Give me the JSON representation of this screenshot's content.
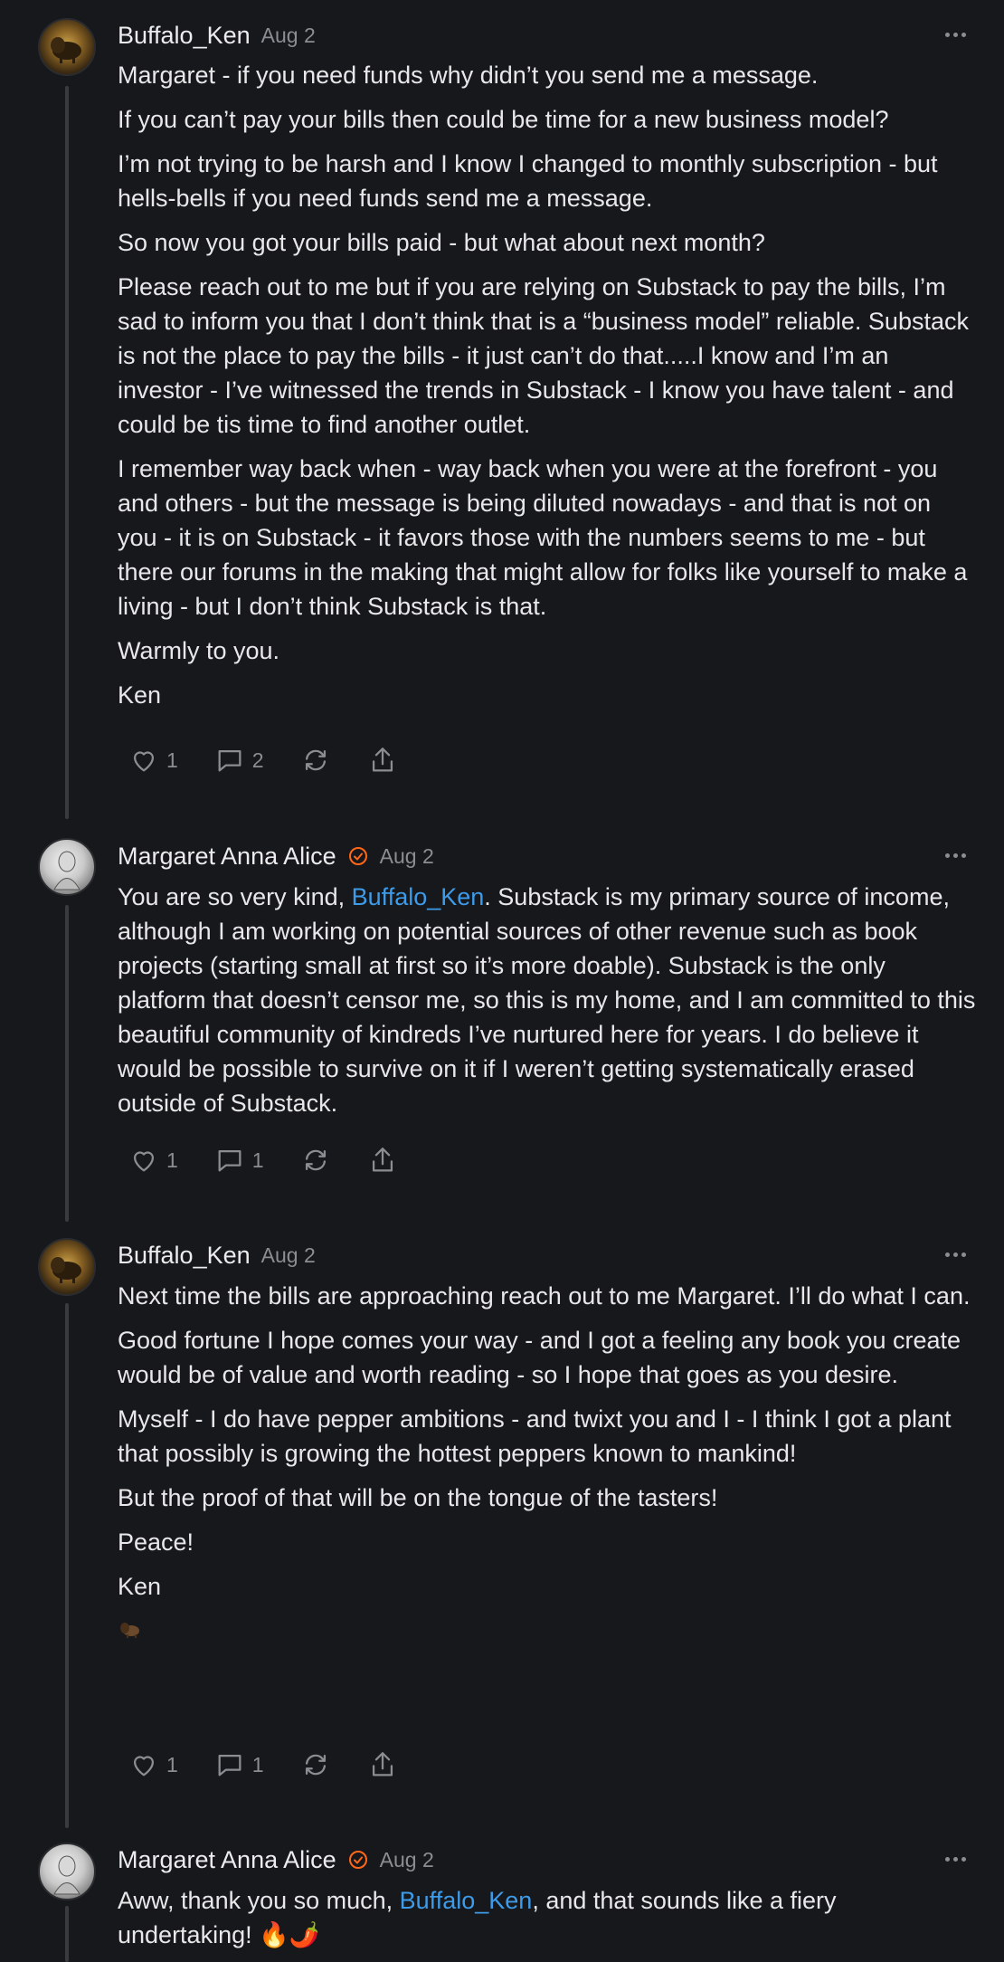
{
  "comments": [
    {
      "author": "Buffalo_Ken",
      "date": "Aug 2",
      "paragraphs": [
        "Margaret - if you need funds why didn’t you send me a message.",
        "If you can’t pay your bills then could be time for a new business model?",
        "I’m not trying to be harsh and I know I changed to monthly subscription - but hells-bells if you need funds send me a message.",
        "So now you got your bills paid - but what about next month?",
        "Please reach out to me but if you are relying on Substack to pay the bills, I’m sad to inform you that I don’t think that is a “business model” reliable. Substack is not the place to pay the bills - it just can’t do that.....I know and I’m an investor - I’ve witnessed the trends in Substack - I know you have talent - and could be tis time to find another outlet.",
        "I remember way back when - way back when you were at the forefront - you and others - but the message is being diluted nowadays - and that is not on you - it is on Substack - it favors those with the numbers seems to me - but there our forums in the making that might allow for folks like yourself to make a living - but I don’t think Substack is that.",
        "Warmly to you.",
        "Ken"
      ],
      "likes": "1",
      "replies": "2"
    },
    {
      "author": "Margaret Anna Alice",
      "date": "Aug 2",
      "text_before": "You are so very kind, ",
      "mention": "Buffalo_Ken",
      "text_after": ". Substack is my primary source of income, although I am working on potential sources of other revenue such as book projects (starting small at first so it’s more doable). Substack is the only platform that doesn’t censor me, so this is my home, and I am committed to this beautiful community of kindreds I’ve nurtured here for years. I do believe it would be possible to survive on it if I weren’t getting systematically erased outside of Substack.",
      "likes": "1",
      "replies": "1"
    },
    {
      "author": "Buffalo_Ken",
      "date": "Aug 2",
      "paragraphs": [
        "Next time the bills are approaching reach out to me Margaret. I’ll do what I can.",
        "Good fortune I hope comes your way - and I got a feeling any book you create would be of value and worth reading - so I hope that goes as you desire.",
        "Myself - I do have pepper ambitions - and twixt you and I - I think I got a plant that possibly is growing the hottest peppers known to mankind!",
        "But the proof of that will be on the tongue of the tasters!",
        "Peace!",
        "Ken"
      ],
      "likes": "1",
      "replies": "1"
    },
    {
      "author": "Margaret Anna Alice",
      "date": "Aug 2",
      "text_before": "Aww, thank you so much, ",
      "mention": "Buffalo_Ken",
      "text_after": ", and that sounds like a fiery undertaking! 🔥🌶️"
    }
  ],
  "icons": {
    "like": "heart-icon",
    "reply": "comment-bubble-icon",
    "restack": "restack-icon",
    "share": "share-icon",
    "more": "more-dots-icon",
    "verified": "verified-check-icon",
    "bison": "bison-emoji-icon"
  },
  "colors": {
    "background": "#17181b",
    "mention": "#3d9be9",
    "verified": "#ff6719",
    "muted": "#8c8d92"
  }
}
